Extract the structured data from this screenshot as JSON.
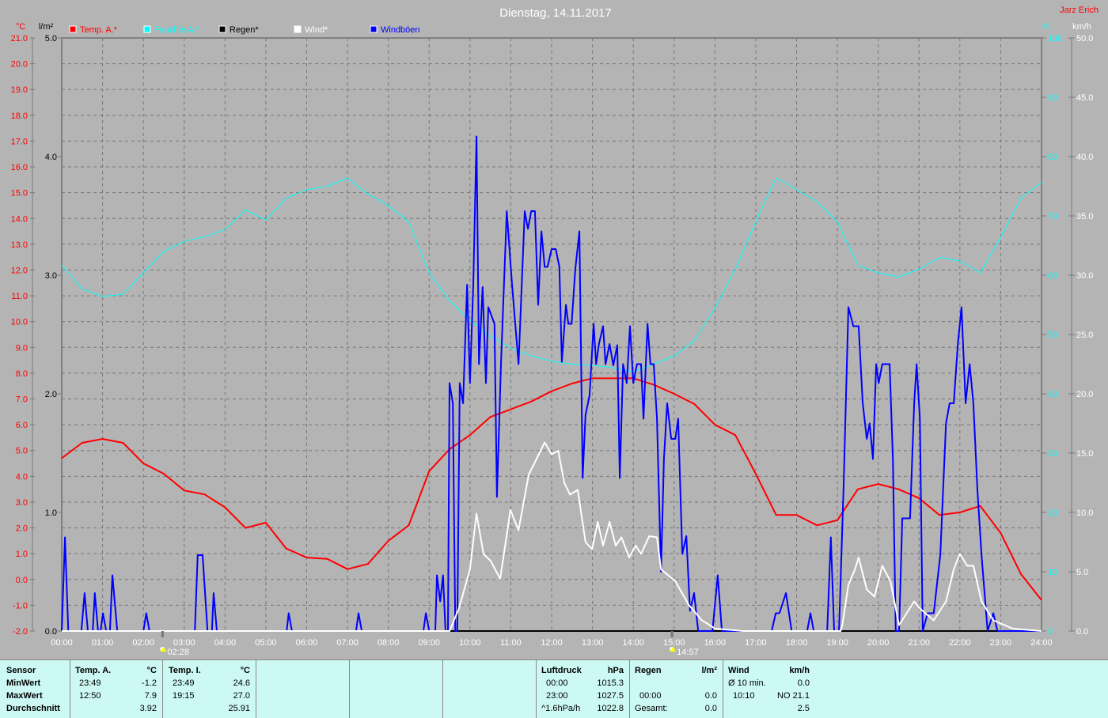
{
  "chart_data": {
    "type": "line",
    "title": "Dienstag, 14.11.2017",
    "author": "Jarz Erich",
    "axes": {
      "temp": {
        "unit": "°C",
        "range": [
          -2,
          21
        ],
        "ticks": [
          "21.0",
          "20.0",
          "19.0",
          "18.0",
          "17.0",
          "16.0",
          "15.0",
          "14.0",
          "13.0",
          "12.0",
          "11.0",
          "10.0",
          "9.0",
          "8.0",
          "7.0",
          "6.0",
          "5.0",
          "4.0",
          "3.0",
          "2.0",
          "1.0",
          "0.0",
          "-1.0",
          "-2.0"
        ]
      },
      "rain": {
        "unit": "l/m²",
        "range": [
          0,
          5
        ],
        "ticks": [
          "5.0",
          "4.0",
          "3.0",
          "2.0",
          "1.0",
          "0.0"
        ]
      },
      "humidity": {
        "unit": "%",
        "range": [
          0,
          100
        ],
        "ticks": [
          "100",
          "90",
          "80",
          "70",
          "60",
          "50",
          "40",
          "30",
          "20",
          "10",
          "0"
        ]
      },
      "wind": {
        "unit": "km/h",
        "range": [
          0,
          50
        ],
        "ticks": [
          "50.0",
          "45.0",
          "40.0",
          "35.0",
          "30.0",
          "25.0",
          "20.0",
          "15.0",
          "10.0",
          "5.0",
          "0.0"
        ]
      },
      "x": {
        "range": [
          0,
          24
        ],
        "ticks": [
          "00:00",
          "01:00",
          "02:00",
          "03:00",
          "04:00",
          "05:00",
          "06:00",
          "07:00",
          "08:00",
          "09:00",
          "10:00",
          "11:00",
          "12:00",
          "13:00",
          "14:00",
          "15:00",
          "16:00",
          "17:00",
          "18:00",
          "19:00",
          "20:00",
          "21:00",
          "22:00",
          "23:00",
          "24:00"
        ]
      }
    },
    "annotations": [
      {
        "label": "02:28",
        "hour": 2.47,
        "icon": "moonrise-icon"
      },
      {
        "label": "14:57",
        "hour": 14.95,
        "icon": "moonset-icon"
      }
    ],
    "legend": [
      {
        "name": "Temp. A.*",
        "color": "#ff0000"
      },
      {
        "name": "Feuchte A.*",
        "color": "#00ffff"
      },
      {
        "name": "Regen*",
        "color": "#000000"
      },
      {
        "name": "Wind*",
        "color": "#ffffff"
      },
      {
        "name": "Windböen",
        "color": "#0000ff"
      }
    ],
    "series": {
      "temp": {
        "axis": "temp",
        "color": "#ff0000",
        "step_hours": 0.5,
        "values": [
          4.7,
          5.3,
          5.45,
          5.3,
          4.5,
          4.1,
          3.45,
          3.3,
          2.8,
          2.0,
          2.2,
          1.2,
          0.85,
          0.8,
          0.4,
          0.6,
          1.5,
          2.1,
          4.2,
          5.05,
          5.6,
          6.3,
          6.6,
          6.9,
          7.3,
          7.6,
          7.8,
          7.8,
          7.8,
          7.55,
          7.2,
          6.8,
          6.0,
          5.6,
          4.1,
          2.5,
          2.5,
          2.1,
          2.3,
          3.5,
          3.7,
          3.5,
          3.15,
          2.5,
          2.6,
          2.85,
          1.8,
          0.2,
          -0.8
        ]
      },
      "humidity": {
        "axis": "humidity",
        "color": "#00ffff",
        "step_hours": 0.5,
        "values": [
          61.7,
          57.7,
          56.4,
          56.8,
          60.4,
          64,
          65.7,
          66.5,
          67.7,
          71,
          69.3,
          73,
          74.4,
          75,
          76.4,
          73.7,
          71.7,
          69,
          60.4,
          55.7,
          52.4,
          49.7,
          47.7,
          46.4,
          45.5,
          45,
          44.8,
          44.4,
          43.7,
          45,
          46.4,
          49,
          54.4,
          61,
          69,
          76.4,
          74.4,
          72.4,
          69,
          61.7,
          60.4,
          59.7,
          61,
          63,
          62.4,
          60.4,
          66.4,
          73,
          75.7
        ]
      },
      "rain": {
        "axis": "rain",
        "color": "#000000",
        "points": [
          [
            0,
            0
          ],
          [
            24,
            0
          ]
        ]
      },
      "wind": {
        "axis": "wind",
        "color": "#ffffff",
        "points": [
          [
            0,
            0
          ],
          [
            9.5,
            0
          ],
          [
            9.73,
            1.9
          ],
          [
            10.0,
            5.2
          ],
          [
            10.16,
            9.9
          ],
          [
            10.33,
            6.5
          ],
          [
            10.51,
            5.9
          ],
          [
            10.74,
            4.4
          ],
          [
            10.99,
            10.2
          ],
          [
            11.19,
            8.5
          ],
          [
            11.44,
            13.2
          ],
          [
            11.63,
            14.5
          ],
          [
            11.83,
            15.9
          ],
          [
            12.0,
            14.9
          ],
          [
            12.16,
            15.2
          ],
          [
            12.31,
            12.5
          ],
          [
            12.45,
            11.5
          ],
          [
            12.64,
            11.9
          ],
          [
            12.83,
            7.5
          ],
          [
            12.99,
            6.9
          ],
          [
            13.13,
            9.2
          ],
          [
            13.26,
            7.2
          ],
          [
            13.42,
            9.2
          ],
          [
            13.57,
            7.2
          ],
          [
            13.71,
            7.9
          ],
          [
            13.9,
            6.2
          ],
          [
            14.06,
            7.2
          ],
          [
            14.19,
            6.5
          ],
          [
            14.39,
            8.0
          ],
          [
            14.58,
            7.9
          ],
          [
            14.68,
            5.2
          ],
          [
            15.03,
            4.2
          ],
          [
            15.36,
            2.2
          ],
          [
            15.68,
            0.9
          ],
          [
            16.01,
            0.2
          ],
          [
            16.7,
            0
          ],
          [
            19.08,
            0
          ],
          [
            19.12,
            0.5
          ],
          [
            19.27,
            3.9
          ],
          [
            19.43,
            5.2
          ],
          [
            19.52,
            6.2
          ],
          [
            19.72,
            3.5
          ],
          [
            19.91,
            2.9
          ],
          [
            20.1,
            5.5
          ],
          [
            20.3,
            4.2
          ],
          [
            20.51,
            0.5
          ],
          [
            20.88,
            2.5
          ],
          [
            21.02,
            1.9
          ],
          [
            21.36,
            0.9
          ],
          [
            21.66,
            2.5
          ],
          [
            21.85,
            5.2
          ],
          [
            22.0,
            6.5
          ],
          [
            22.18,
            5.5
          ],
          [
            22.33,
            5.5
          ],
          [
            22.53,
            2.5
          ],
          [
            22.82,
            0.9
          ],
          [
            23.3,
            0.2
          ],
          [
            24,
            0
          ]
        ]
      },
      "gusts": {
        "axis": "wind",
        "color": "#0000ff",
        "points": [
          [
            0,
            0
          ],
          [
            0.08,
            7.9
          ],
          [
            0.16,
            0
          ],
          [
            0.48,
            0
          ],
          [
            0.56,
            3.2
          ],
          [
            0.64,
            0
          ],
          [
            0.76,
            0
          ],
          [
            0.81,
            3.2
          ],
          [
            0.89,
            0
          ],
          [
            0.95,
            0
          ],
          [
            1.01,
            1.5
          ],
          [
            1.09,
            0
          ],
          [
            1.18,
            0
          ],
          [
            1.24,
            4.7
          ],
          [
            1.36,
            0
          ],
          [
            2.0,
            0
          ],
          [
            2.07,
            1.5
          ],
          [
            2.15,
            0
          ],
          [
            3.26,
            0
          ],
          [
            3.33,
            6.4
          ],
          [
            3.45,
            6.4
          ],
          [
            3.57,
            0
          ],
          [
            3.68,
            0
          ],
          [
            3.72,
            3.2
          ],
          [
            3.8,
            0
          ],
          [
            5.51,
            0
          ],
          [
            5.56,
            1.5
          ],
          [
            5.64,
            0
          ],
          [
            7.21,
            0
          ],
          [
            7.27,
            1.5
          ],
          [
            7.35,
            0
          ],
          [
            8.86,
            0
          ],
          [
            8.92,
            1.5
          ],
          [
            9.0,
            0
          ],
          [
            9.15,
            0
          ],
          [
            9.19,
            4.7
          ],
          [
            9.27,
            2.5
          ],
          [
            9.34,
            4.7
          ],
          [
            9.4,
            0
          ],
          [
            9.46,
            0
          ],
          [
            9.5,
            20.9
          ],
          [
            9.58,
            19.2
          ],
          [
            9.64,
            0
          ],
          [
            9.69,
            0
          ],
          [
            9.75,
            20.9
          ],
          [
            9.83,
            19.2
          ],
          [
            9.93,
            29.2
          ],
          [
            10.0,
            20.9
          ],
          [
            10.08,
            29.2
          ],
          [
            10.16,
            41.7
          ],
          [
            10.22,
            22.5
          ],
          [
            10.31,
            29.0
          ],
          [
            10.39,
            20.9
          ],
          [
            10.45,
            27.3
          ],
          [
            10.6,
            25.9
          ],
          [
            10.66,
            11.3
          ],
          [
            10.76,
            22.5
          ],
          [
            10.9,
            35.4
          ],
          [
            11.03,
            29.2
          ],
          [
            11.19,
            22.5
          ],
          [
            11.34,
            35.4
          ],
          [
            11.42,
            33.9
          ],
          [
            11.5,
            35.4
          ],
          [
            11.59,
            35.4
          ],
          [
            11.67,
            27.5
          ],
          [
            11.75,
            33.7
          ],
          [
            11.83,
            30.7
          ],
          [
            11.9,
            30.7
          ],
          [
            12.0,
            32.2
          ],
          [
            12.1,
            32.2
          ],
          [
            12.19,
            30.7
          ],
          [
            12.25,
            22.7
          ],
          [
            12.35,
            27.5
          ],
          [
            12.41,
            25.9
          ],
          [
            12.49,
            25.9
          ],
          [
            12.58,
            30.5
          ],
          [
            12.68,
            33.7
          ],
          [
            12.76,
            12.9
          ],
          [
            12.83,
            18.2
          ],
          [
            12.93,
            19.9
          ],
          [
            13.03,
            25.9
          ],
          [
            13.09,
            22.5
          ],
          [
            13.16,
            24.2
          ],
          [
            13.26,
            25.7
          ],
          [
            13.32,
            22.5
          ],
          [
            13.42,
            24.2
          ],
          [
            13.51,
            22.4
          ],
          [
            13.61,
            24.1
          ],
          [
            13.67,
            12.9
          ],
          [
            13.75,
            22.5
          ],
          [
            13.84,
            20.9
          ],
          [
            13.92,
            25.7
          ],
          [
            14.0,
            20.9
          ],
          [
            14.09,
            22.5
          ],
          [
            14.19,
            22.5
          ],
          [
            14.25,
            17.9
          ],
          [
            14.35,
            25.9
          ],
          [
            14.42,
            22.5
          ],
          [
            14.5,
            22.5
          ],
          [
            14.58,
            17.9
          ],
          [
            14.68,
            5.0
          ],
          [
            14.75,
            14.5
          ],
          [
            14.83,
            19.2
          ],
          [
            14.93,
            16.2
          ],
          [
            15.03,
            16.2
          ],
          [
            15.1,
            17.9
          ],
          [
            15.2,
            6.5
          ],
          [
            15.3,
            8.0
          ],
          [
            15.39,
            1.7
          ],
          [
            15.49,
            3.2
          ],
          [
            15.59,
            0
          ],
          [
            15.94,
            0
          ],
          [
            16.07,
            4.7
          ],
          [
            16.17,
            0
          ],
          [
            17.39,
            0
          ],
          [
            17.49,
            1.5
          ],
          [
            17.58,
            1.5
          ],
          [
            17.74,
            3.2
          ],
          [
            17.88,
            0
          ],
          [
            18.26,
            0
          ],
          [
            18.34,
            1.5
          ],
          [
            18.42,
            0
          ],
          [
            18.75,
            0
          ],
          [
            18.84,
            7.9
          ],
          [
            18.92,
            0
          ],
          [
            19.04,
            0
          ],
          [
            19.15,
            11.9
          ],
          [
            19.27,
            27.3
          ],
          [
            19.39,
            25.7
          ],
          [
            19.52,
            25.7
          ],
          [
            19.62,
            19.2
          ],
          [
            19.72,
            16.2
          ],
          [
            19.79,
            17.5
          ],
          [
            19.87,
            14.5
          ],
          [
            19.95,
            22.5
          ],
          [
            20.01,
            20.9
          ],
          [
            20.1,
            22.5
          ],
          [
            20.28,
            22.5
          ],
          [
            20.36,
            14.5
          ],
          [
            20.43,
            0
          ],
          [
            20.51,
            0
          ],
          [
            20.59,
            9.5
          ],
          [
            20.78,
            9.5
          ],
          [
            20.88,
            19.2
          ],
          [
            20.94,
            22.5
          ],
          [
            21.02,
            17.9
          ],
          [
            21.09,
            0
          ],
          [
            21.21,
            1.5
          ],
          [
            21.36,
            1.5
          ],
          [
            21.52,
            6.4
          ],
          [
            21.66,
            17.5
          ],
          [
            21.75,
            19.2
          ],
          [
            21.85,
            19.2
          ],
          [
            21.95,
            24.2
          ],
          [
            22.04,
            27.3
          ],
          [
            22.14,
            19.2
          ],
          [
            22.24,
            22.5
          ],
          [
            22.33,
            19.2
          ],
          [
            22.43,
            11.9
          ],
          [
            22.53,
            6.4
          ],
          [
            22.68,
            0
          ],
          [
            22.82,
            1.5
          ],
          [
            22.92,
            0
          ],
          [
            24,
            0
          ]
        ]
      }
    }
  },
  "stats": {
    "temp_a": {
      "header": [
        "Sensor",
        "Temp. A.",
        "°C"
      ],
      "rows": [
        [
          "MinWert",
          "23:49",
          "-1.2"
        ],
        [
          "MaxWert",
          "12:50",
          "7.9"
        ],
        [
          "Durchschnitt",
          "",
          "3.92"
        ]
      ]
    },
    "temp_i": {
      "header": [
        "Temp. I.",
        "°C"
      ],
      "rows": [
        [
          "23:49",
          "24.6"
        ],
        [
          "19:15",
          "27.0"
        ],
        [
          "",
          "25.91"
        ]
      ]
    },
    "pressure": {
      "header": [
        "Luftdruck",
        "hPa"
      ],
      "rows": [
        [
          "00:00",
          "1015.3"
        ],
        [
          "23:00",
          "1027.5"
        ],
        [
          "^1.6hPa/h",
          "1022.8"
        ]
      ]
    },
    "rain": {
      "header": [
        "Regen",
        "l/m²"
      ],
      "rows": [
        [
          "",
          ""
        ],
        [
          "00:00",
          "0.0"
        ],
        [
          "Gesamt:",
          "0.0"
        ]
      ]
    },
    "wind": {
      "header": [
        "Wind",
        "km/h"
      ],
      "rows": [
        [
          "Ø 10 min.",
          "0.0"
        ],
        [
          "10:10",
          "NO 21.1"
        ],
        [
          "",
          "2.5"
        ]
      ]
    }
  }
}
